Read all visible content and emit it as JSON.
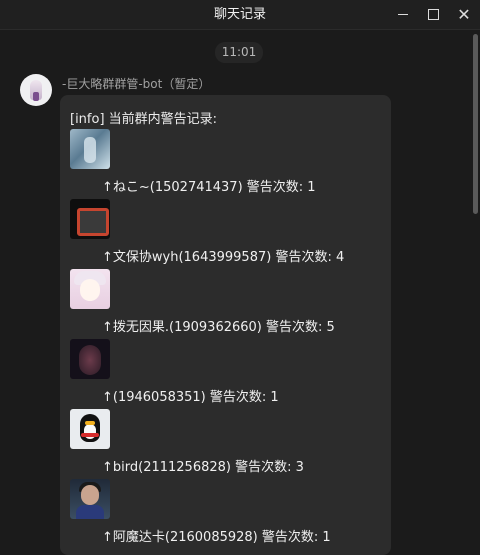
{
  "window": {
    "title": "聊天记录",
    "controls": {
      "minimize": "minimize-icon",
      "maximize": "maximize-icon",
      "close": "close-icon"
    }
  },
  "chat": {
    "timestamp": "11:01",
    "message": {
      "sender": "-巨大略群群管-bot（暂定）",
      "header": "[info] 当前群内警告记录:",
      "entries": [
        {
          "text": "↑ねこ~(1502741437) 警告次数: 1"
        },
        {
          "text": "↑文保协wyh(1643999587) 警告次数: 4"
        },
        {
          "text": "↑拨无因果.(1909362660) 警告次数: 5"
        },
        {
          "text": "↑(1946058351) 警告次数: 1"
        },
        {
          "text": "↑bird(2111256828) 警告次数: 3"
        },
        {
          "text": "↑阿魔达卡(2160085928) 警告次数: 1"
        }
      ]
    }
  },
  "colors": {
    "background": "#1b1b1b",
    "bubble": "#2c2c2c",
    "text": "#e8e8e8",
    "muted": "#a0a0a0"
  }
}
